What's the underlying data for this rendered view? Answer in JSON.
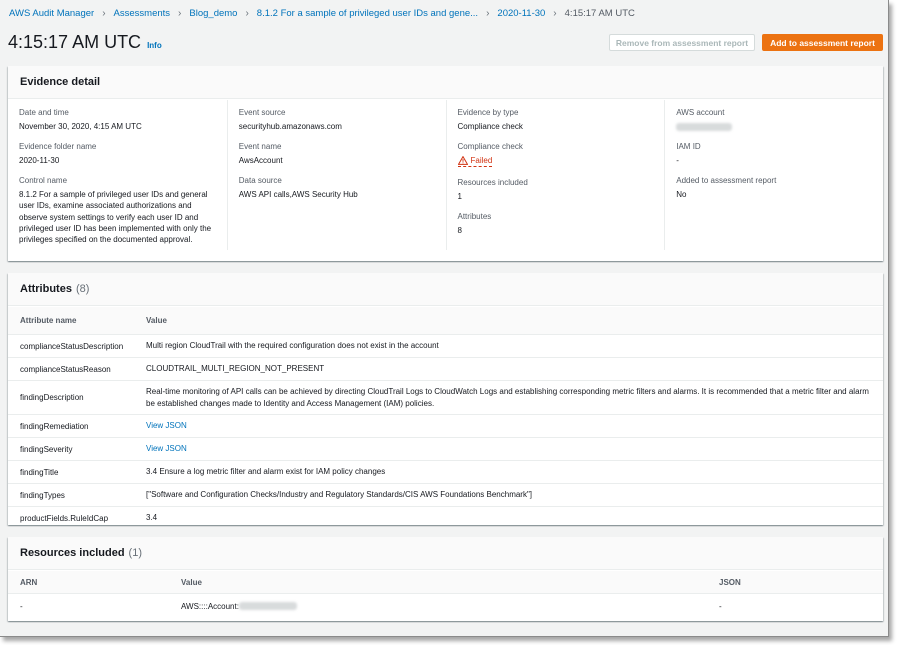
{
  "breadcrumb": [
    {
      "label": "AWS Audit Manager",
      "link": true
    },
    {
      "label": "Assessments",
      "link": true
    },
    {
      "label": "Blog_demo",
      "link": true
    },
    {
      "label": "8.1.2 For a sample of privileged user IDs and gene...",
      "link": true
    },
    {
      "label": "2020-11-30",
      "link": true
    },
    {
      "label": "4:15:17 AM UTC",
      "link": false
    }
  ],
  "header": {
    "title": "4:15:17 AM UTC",
    "info": "Info",
    "remove_button": "Remove from assessment report",
    "add_button": "Add to assessment report"
  },
  "evidence_detail": {
    "title": "Evidence detail",
    "date_label": "Date and time",
    "date_value": "November 30, 2020, 4:15 AM UTC",
    "folder_label": "Evidence folder name",
    "folder_value": "2020-11-30",
    "control_label": "Control name",
    "control_value": "8.1.2 For a sample of privileged user IDs and general user IDs, examine associated authorizations and observe system settings to verify each user ID and privileged user ID has been implemented with only the privileges specified on the documented approval.",
    "source_label": "Event source",
    "source_value": "securityhub.amazonaws.com",
    "event_label": "Event name",
    "event_value": "AwsAccount",
    "datasource_label": "Data source",
    "datasource_value": "AWS API calls,AWS Security Hub",
    "bytype_label": "Evidence by type",
    "bytype_value": "Compliance check",
    "compliance_label": "Compliance check",
    "compliance_value": "Failed",
    "resources_label": "Resources included",
    "resources_value": "1",
    "attributes_label": "Attributes",
    "attributes_value": "8",
    "account_label": "AWS account",
    "iam_label": "IAM ID",
    "iam_value": "-",
    "added_label": "Added to assessment report",
    "added_value": "No"
  },
  "attributes": {
    "title": "Attributes",
    "count": "(8)",
    "col_name": "Attribute name",
    "col_value": "Value",
    "rows": [
      {
        "name": "complianceStatusDescription",
        "value": "Multi region CloudTrail with the required configuration does not exist in the account"
      },
      {
        "name": "complianceStatusReason",
        "value": "CLOUDTRAIL_MULTI_REGION_NOT_PRESENT"
      },
      {
        "name": "findingDescription",
        "value": "Real-time monitoring of API calls can be achieved by directing CloudTrail Logs to CloudWatch Logs and establishing corresponding metric filters and alarms. It is recommended that a metric filter and alarm be established changes made to Identity and Access Management (IAM) policies."
      },
      {
        "name": "findingRemediation",
        "value": "View JSON"
      },
      {
        "name": "findingSeverity",
        "value": "View JSON"
      },
      {
        "name": "findingTitle",
        "value": "3.4 Ensure a log metric filter and alarm exist for IAM policy changes"
      },
      {
        "name": "findingTypes",
        "value": "[\"Software and Configuration Checks/Industry and Regulatory Standards/CIS AWS Foundations Benchmark\"]"
      },
      {
        "name": "productFields.RuleIdCap",
        "value": "3.4"
      }
    ]
  },
  "resources": {
    "title": "Resources included",
    "count": "(1)",
    "col_arn": "ARN",
    "col_value": "Value",
    "col_json": "JSON",
    "row": {
      "arn": "-",
      "value": "AWS::::Account:",
      "json": "-"
    }
  }
}
